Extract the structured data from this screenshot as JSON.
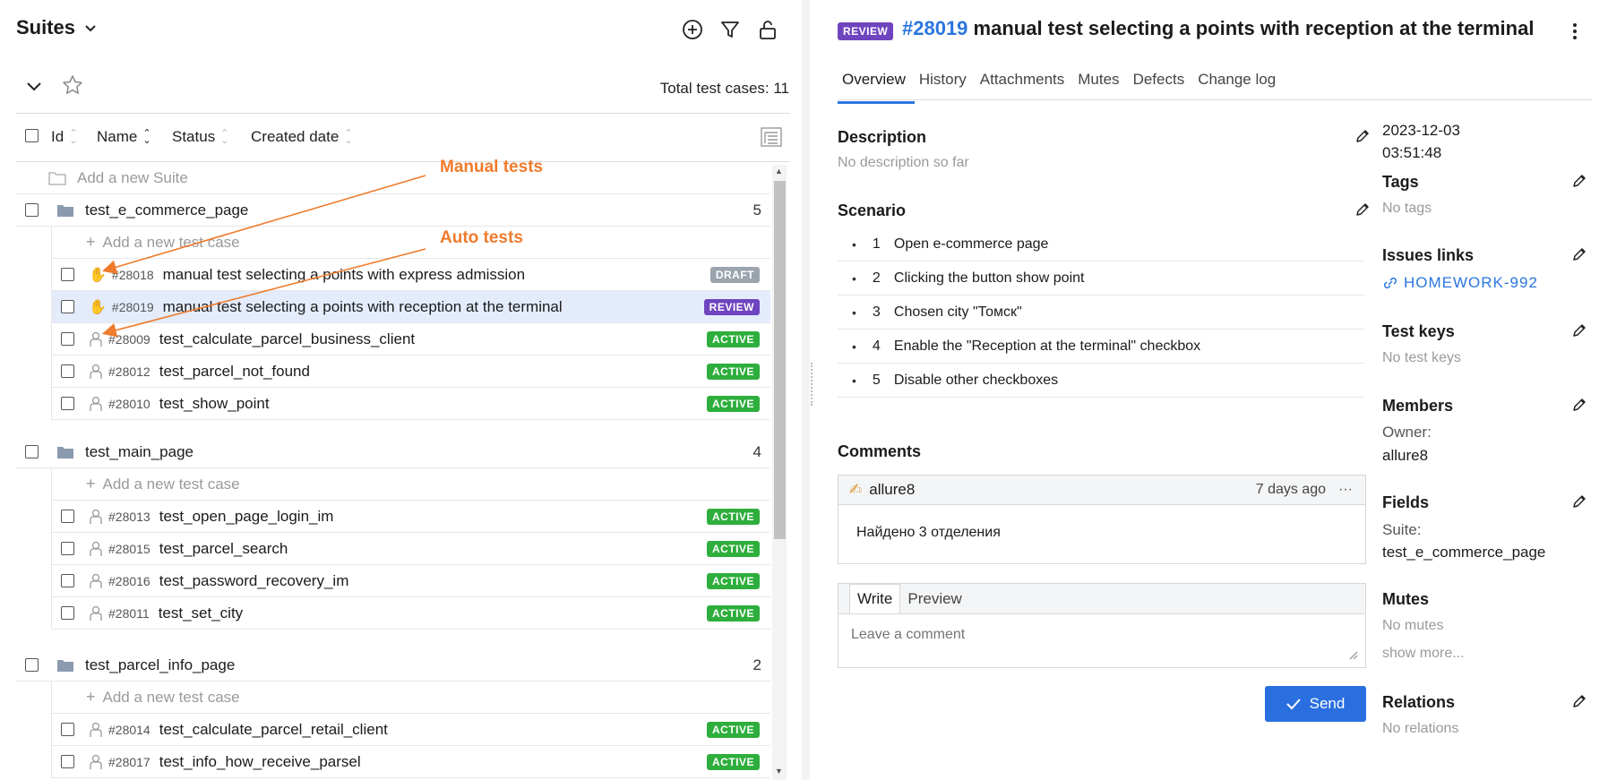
{
  "left": {
    "title": "Suites",
    "total_label": "Total test cases: 11",
    "columns": {
      "id": "Id",
      "name": "Name",
      "status": "Status",
      "created": "Created date"
    },
    "add_suite": "Add a new Suite",
    "add_case": "Add a new test case",
    "annotations": {
      "manual": "Manual tests",
      "auto": "Auto tests"
    },
    "suites": [
      {
        "name": "test_e_commerce_page",
        "count": "5",
        "cases": [
          {
            "id": "#28018",
            "name": "manual test selecting a points with express admission",
            "status": "DRAFT",
            "type": "manual"
          },
          {
            "id": "#28019",
            "name": "manual test selecting a points with reception at the terminal",
            "status": "REVIEW",
            "type": "manual"
          },
          {
            "id": "#28009",
            "name": "test_calculate_parcel_business_client",
            "status": "ACTIVE",
            "type": "auto"
          },
          {
            "id": "#28012",
            "name": "test_parcel_not_found",
            "status": "ACTIVE",
            "type": "auto"
          },
          {
            "id": "#28010",
            "name": "test_show_point",
            "status": "ACTIVE",
            "type": "auto"
          }
        ]
      },
      {
        "name": "test_main_page",
        "count": "4",
        "cases": [
          {
            "id": "#28013",
            "name": "test_open_page_login_im",
            "status": "ACTIVE",
            "type": "auto"
          },
          {
            "id": "#28015",
            "name": "test_parcel_search",
            "status": "ACTIVE",
            "type": "auto"
          },
          {
            "id": "#28016",
            "name": "test_password_recovery_im",
            "status": "ACTIVE",
            "type": "auto"
          },
          {
            "id": "#28011",
            "name": "test_set_city",
            "status": "ACTIVE",
            "type": "auto"
          }
        ]
      },
      {
        "name": "test_parcel_info_page",
        "count": "2",
        "cases": [
          {
            "id": "#28014",
            "name": "test_calculate_parcel_retail_client",
            "status": "ACTIVE",
            "type": "auto"
          },
          {
            "id": "#28017",
            "name": "test_info_how_receive_parsel",
            "status": "ACTIVE",
            "type": "auto"
          }
        ]
      }
    ]
  },
  "detail": {
    "badge": "REVIEW",
    "id": "#28019",
    "title": "manual test selecting a points with reception at the terminal",
    "tabs": [
      "Overview",
      "History",
      "Attachments",
      "Mutes",
      "Defects",
      "Change log"
    ],
    "description_label": "Description",
    "description_value": "No description so far",
    "scenario_label": "Scenario",
    "steps": [
      {
        "n": "1",
        "text": "Open e-commerce page"
      },
      {
        "n": "2",
        "text": "Clicking the button show point"
      },
      {
        "n": "3",
        "text": "Chosen city \"Томск\""
      },
      {
        "n": "4",
        "text": "Enable the \"Reception at the terminal\" checkbox"
      },
      {
        "n": "5",
        "text": "Disable other checkboxes"
      }
    ],
    "comments_label": "Comments",
    "comment": {
      "author": "allure8",
      "time": "7 days ago",
      "text": "Найдено 3 отделения"
    },
    "editor": {
      "write": "Write",
      "preview": "Preview",
      "placeholder": "Leave a comment"
    },
    "send": "Send"
  },
  "side": {
    "date": "2023-12-03",
    "time": "03:51:48",
    "tags_label": "Tags",
    "tags_value": "No tags",
    "issues_label": "Issues links",
    "issue": "HOMEWORK-992",
    "keys_label": "Test keys",
    "keys_value": "No test keys",
    "members_label": "Members",
    "owner_label": "Owner:",
    "owner": "allure8",
    "fields_label": "Fields",
    "suite_label": "Suite:",
    "suite_value": "test_e_commerce_page",
    "mutes_label": "Mutes",
    "mutes_value": "No mutes",
    "show_more": "show more...",
    "relations_label": "Relations",
    "relations_value": "No relations"
  },
  "colors": {
    "accent": "#2a76e0",
    "active": "#2eae3c",
    "review": "#6f44bf",
    "draft": "#9ba3ad",
    "annotation": "#ef7b2c"
  },
  "icons": [
    "chevron-down-icon",
    "add-circle-icon",
    "filter-icon",
    "unlock-icon",
    "star-icon",
    "tree-view-icon",
    "folder-icon",
    "hand-icon",
    "robot-icon",
    "pencil-icon",
    "link-icon",
    "kebab-icon",
    "check-icon"
  ]
}
